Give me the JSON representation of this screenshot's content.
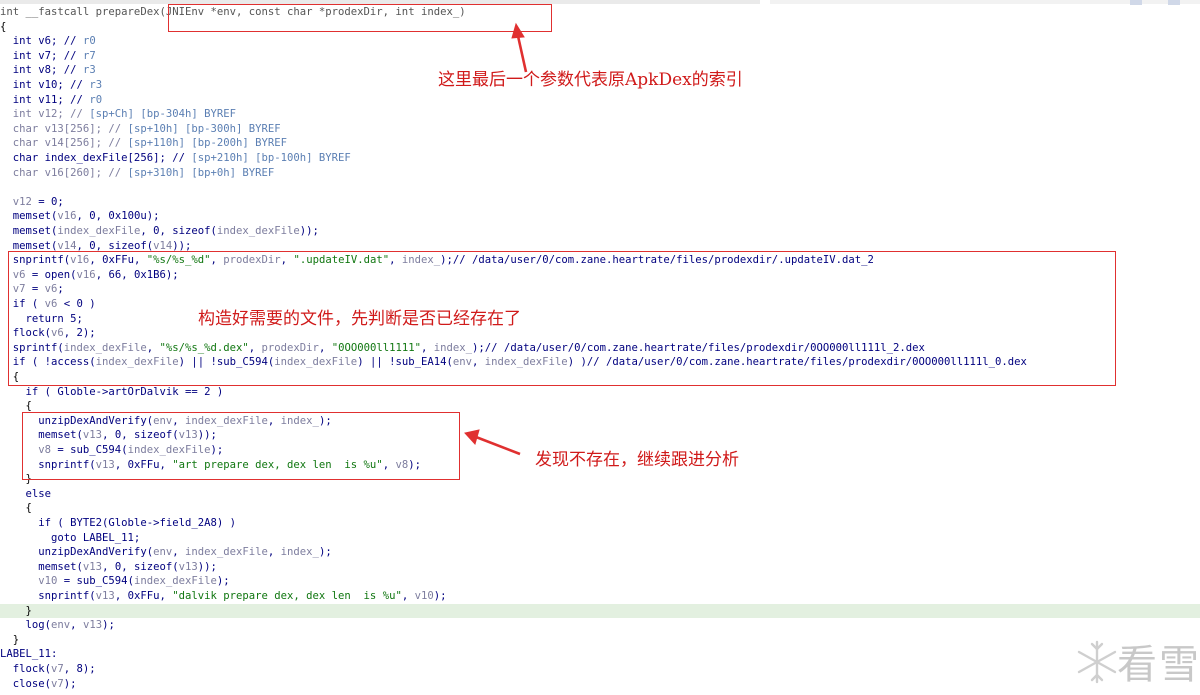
{
  "code": {
    "lines": [
      [
        {
          "t": "int __fastcall prepareDex(JNIEnv *env, const char *prodexDir, int index_)",
          "c": "gy"
        }
      ],
      [
        {
          "t": "{",
          "c": "pl"
        }
      ],
      [
        {
          "t": "  int ",
          "c": "kw"
        },
        {
          "t": "v6",
          "c": "kw"
        },
        {
          "t": "; // ",
          "c": "kw"
        },
        {
          "t": "r0",
          "c": "cm"
        }
      ],
      [
        {
          "t": "  int ",
          "c": "kw"
        },
        {
          "t": "v7",
          "c": "kw"
        },
        {
          "t": "; // ",
          "c": "kw"
        },
        {
          "t": "r7",
          "c": "cm"
        }
      ],
      [
        {
          "t": "  int ",
          "c": "kw"
        },
        {
          "t": "v8",
          "c": "kw"
        },
        {
          "t": "; // ",
          "c": "kw"
        },
        {
          "t": "r3",
          "c": "cm"
        }
      ],
      [
        {
          "t": "  int ",
          "c": "kw"
        },
        {
          "t": "v10",
          "c": "kw"
        },
        {
          "t": "; // ",
          "c": "kw"
        },
        {
          "t": "r3",
          "c": "cm"
        }
      ],
      [
        {
          "t": "  int ",
          "c": "kw"
        },
        {
          "t": "v11",
          "c": "kw"
        },
        {
          "t": "; // ",
          "c": "kw"
        },
        {
          "t": "r0",
          "c": "cm"
        }
      ],
      [
        {
          "t": "  int v12; // ",
          "c": "vr"
        },
        {
          "t": "[sp+Ch] [bp-304h] BYREF",
          "c": "cm"
        }
      ],
      [
        {
          "t": "  char v13[256]; // ",
          "c": "vr"
        },
        {
          "t": "[sp+10h] [bp-300h] BYREF",
          "c": "cm"
        }
      ],
      [
        {
          "t": "  char v14[256]; // ",
          "c": "vr"
        },
        {
          "t": "[sp+110h] [bp-200h] BYREF",
          "c": "cm"
        }
      ],
      [
        {
          "t": "  char index_dexFile[256]; // ",
          "c": "kw"
        },
        {
          "t": "[sp+210h] [bp-100h] BYREF",
          "c": "cm"
        }
      ],
      [
        {
          "t": "  char v16[260]; // ",
          "c": "vr"
        },
        {
          "t": "[sp+310h] [bp+0h] BYREF",
          "c": "cm"
        }
      ],
      [
        {
          "t": "",
          "c": "pl"
        }
      ],
      [
        {
          "t": "  v12",
          "c": "vr"
        },
        {
          "t": " = 0;",
          "c": "kw"
        }
      ],
      [
        {
          "t": "  memset(",
          "c": "fn"
        },
        {
          "t": "v16",
          "c": "vr"
        },
        {
          "t": ", 0, 0x100u);",
          "c": "kw"
        }
      ],
      [
        {
          "t": "  memset(",
          "c": "fn"
        },
        {
          "t": "index_dexFile",
          "c": "vr"
        },
        {
          "t": ", 0, sizeof(",
          "c": "kw"
        },
        {
          "t": "index_dexFile",
          "c": "vr"
        },
        {
          "t": "));",
          "c": "kw"
        }
      ],
      [
        {
          "t": "  memset(",
          "c": "fn"
        },
        {
          "t": "v14",
          "c": "vr"
        },
        {
          "t": ", 0, sizeof(",
          "c": "kw"
        },
        {
          "t": "v14",
          "c": "vr"
        },
        {
          "t": "));",
          "c": "kw"
        }
      ],
      [
        {
          "t": "  snprintf(",
          "c": "fn"
        },
        {
          "t": "v16",
          "c": "vr"
        },
        {
          "t": ", 0xFFu, ",
          "c": "kw"
        },
        {
          "t": "\"%s/%s_%d\"",
          "c": "st"
        },
        {
          "t": ", ",
          "c": "kw"
        },
        {
          "t": "prodexDir",
          "c": "vr"
        },
        {
          "t": ", ",
          "c": "kw"
        },
        {
          "t": "\".updateIV.dat\"",
          "c": "st"
        },
        {
          "t": ", ",
          "c": "kw"
        },
        {
          "t": "index_",
          "c": "vr"
        },
        {
          "t": ");// /data/user/0/com.zane.heartrate/files/prodexdir/.updateIV.dat_2",
          "c": "kw"
        }
      ],
      [
        {
          "t": "  v6",
          "c": "vr"
        },
        {
          "t": " = open(",
          "c": "fn"
        },
        {
          "t": "v16",
          "c": "vr"
        },
        {
          "t": ", 66, 0x1B6);",
          "c": "kw"
        }
      ],
      [
        {
          "t": "  v7",
          "c": "vr"
        },
        {
          "t": " = ",
          "c": "kw"
        },
        {
          "t": "v6",
          "c": "vr"
        },
        {
          "t": ";",
          "c": "kw"
        }
      ],
      [
        {
          "t": "  if ( ",
          "c": "kw"
        },
        {
          "t": "v6",
          "c": "vr"
        },
        {
          "t": " < 0 )",
          "c": "kw"
        }
      ],
      [
        {
          "t": "    return 5;",
          "c": "kw"
        }
      ],
      [
        {
          "t": "  flock(",
          "c": "fn"
        },
        {
          "t": "v6",
          "c": "vr"
        },
        {
          "t": ", 2);",
          "c": "kw"
        }
      ],
      [
        {
          "t": "  sprintf(",
          "c": "fn"
        },
        {
          "t": "index_dexFile",
          "c": "vr"
        },
        {
          "t": ", ",
          "c": "kw"
        },
        {
          "t": "\"%s/%s_%d.dex\"",
          "c": "st"
        },
        {
          "t": ", ",
          "c": "kw"
        },
        {
          "t": "prodexDir",
          "c": "vr"
        },
        {
          "t": ", ",
          "c": "kw"
        },
        {
          "t": "\"0OO000ll1111\"",
          "c": "st"
        },
        {
          "t": ", ",
          "c": "kw"
        },
        {
          "t": "index_",
          "c": "vr"
        },
        {
          "t": ");// /data/user/0/com.zane.heartrate/files/prodexdir/0OO000ll111l_2.dex",
          "c": "kw"
        }
      ],
      [
        {
          "t": "  if ( !access(",
          "c": "fn"
        },
        {
          "t": "index_dexFile",
          "c": "vr"
        },
        {
          "t": ") || !sub_C594(",
          "c": "kw"
        },
        {
          "t": "index_dexFile",
          "c": "vr"
        },
        {
          "t": ") || !sub_EA14(",
          "c": "kw"
        },
        {
          "t": "env",
          "c": "vr"
        },
        {
          "t": ", ",
          "c": "kw"
        },
        {
          "t": "index_dexFile",
          "c": "vr"
        },
        {
          "t": ") )// /data/user/0/com.zane.heartrate/files/prodexdir/0OO000ll111l_0.dex",
          "c": "kw"
        }
      ],
      [
        {
          "t": "  {",
          "c": "pl"
        }
      ],
      [
        {
          "t": "    if ( Globle->artOrDalvik == 2 )",
          "c": "kw"
        }
      ],
      [
        {
          "t": "    {",
          "c": "pl"
        }
      ],
      [
        {
          "t": "      unzipDexAndVerify(",
          "c": "fn"
        },
        {
          "t": "env",
          "c": "vr"
        },
        {
          "t": ", ",
          "c": "kw"
        },
        {
          "t": "index_dexFile",
          "c": "vr"
        },
        {
          "t": ", ",
          "c": "kw"
        },
        {
          "t": "index_",
          "c": "vr"
        },
        {
          "t": ");",
          "c": "kw"
        }
      ],
      [
        {
          "t": "      memset(",
          "c": "fn"
        },
        {
          "t": "v13",
          "c": "vr"
        },
        {
          "t": ", 0, sizeof(",
          "c": "kw"
        },
        {
          "t": "v13",
          "c": "vr"
        },
        {
          "t": "));",
          "c": "kw"
        }
      ],
      [
        {
          "t": "      v8",
          "c": "vr"
        },
        {
          "t": " = sub_C594(",
          "c": "kw"
        },
        {
          "t": "index_dexFile",
          "c": "vr"
        },
        {
          "t": ");",
          "c": "kw"
        }
      ],
      [
        {
          "t": "      snprintf(",
          "c": "fn"
        },
        {
          "t": "v13",
          "c": "vr"
        },
        {
          "t": ", 0xFFu, ",
          "c": "kw"
        },
        {
          "t": "\"art prepare dex, dex len  is %u\"",
          "c": "st"
        },
        {
          "t": ", ",
          "c": "kw"
        },
        {
          "t": "v8",
          "c": "vr"
        },
        {
          "t": ");",
          "c": "kw"
        }
      ],
      [
        {
          "t": "    }",
          "c": "pl"
        }
      ],
      [
        {
          "t": "    else",
          "c": "kw"
        }
      ],
      [
        {
          "t": "    {",
          "c": "pl"
        }
      ],
      [
        {
          "t": "      if ( BYTE2(Globle->field_2A8) )",
          "c": "kw"
        }
      ],
      [
        {
          "t": "        goto LABEL_11;",
          "c": "kw"
        }
      ],
      [
        {
          "t": "      unzipDexAndVerify(",
          "c": "fn"
        },
        {
          "t": "env",
          "c": "vr"
        },
        {
          "t": ", ",
          "c": "kw"
        },
        {
          "t": "index_dexFile",
          "c": "vr"
        },
        {
          "t": ", ",
          "c": "kw"
        },
        {
          "t": "index_",
          "c": "vr"
        },
        {
          "t": ");",
          "c": "kw"
        }
      ],
      [
        {
          "t": "      memset(",
          "c": "fn"
        },
        {
          "t": "v13",
          "c": "vr"
        },
        {
          "t": ", 0, sizeof(",
          "c": "kw"
        },
        {
          "t": "v13",
          "c": "vr"
        },
        {
          "t": "));",
          "c": "kw"
        }
      ],
      [
        {
          "t": "      v10",
          "c": "vr"
        },
        {
          "t": " = sub_C594(",
          "c": "kw"
        },
        {
          "t": "index_dexFile",
          "c": "vr"
        },
        {
          "t": ");",
          "c": "kw"
        }
      ],
      [
        {
          "t": "      snprintf(",
          "c": "fn"
        },
        {
          "t": "v13",
          "c": "vr"
        },
        {
          "t": ", 0xFFu, ",
          "c": "kw"
        },
        {
          "t": "\"dalvik prepare dex, dex len  is %u\"",
          "c": "st"
        },
        {
          "t": ", ",
          "c": "kw"
        },
        {
          "t": "v10",
          "c": "vr"
        },
        {
          "t": ");",
          "c": "kw"
        }
      ],
      [
        {
          "t": "    }",
          "c": "pl"
        }
      ],
      [
        {
          "t": "    log(",
          "c": "fn"
        },
        {
          "t": "env",
          "c": "vr"
        },
        {
          "t": ", ",
          "c": "kw"
        },
        {
          "t": "v13",
          "c": "vr"
        },
        {
          "t": ");",
          "c": "kw"
        }
      ],
      [
        {
          "t": "  }",
          "c": "pl"
        }
      ],
      [
        {
          "t": "LABEL_11:",
          "c": "kw"
        }
      ],
      [
        {
          "t": "  flock(",
          "c": "fn"
        },
        {
          "t": "v7",
          "c": "vr"
        },
        {
          "t": ", 8);",
          "c": "kw"
        }
      ],
      [
        {
          "t": "  close(",
          "c": "fn"
        },
        {
          "t": "v7",
          "c": "vr"
        },
        {
          "t": ");",
          "c": "kw"
        }
      ]
    ],
    "highlighted_line": 41
  },
  "annotations": {
    "note1": "这里最后一个参数代表原ApkDex的索引",
    "note2": "构造好需要的文件，先判断是否已经存在了",
    "note3": "发现不存在，继续跟进分析",
    "annotation_color": "#e03030"
  },
  "watermark": {
    "text": "看雪",
    "icon": "snowflake-icon"
  }
}
